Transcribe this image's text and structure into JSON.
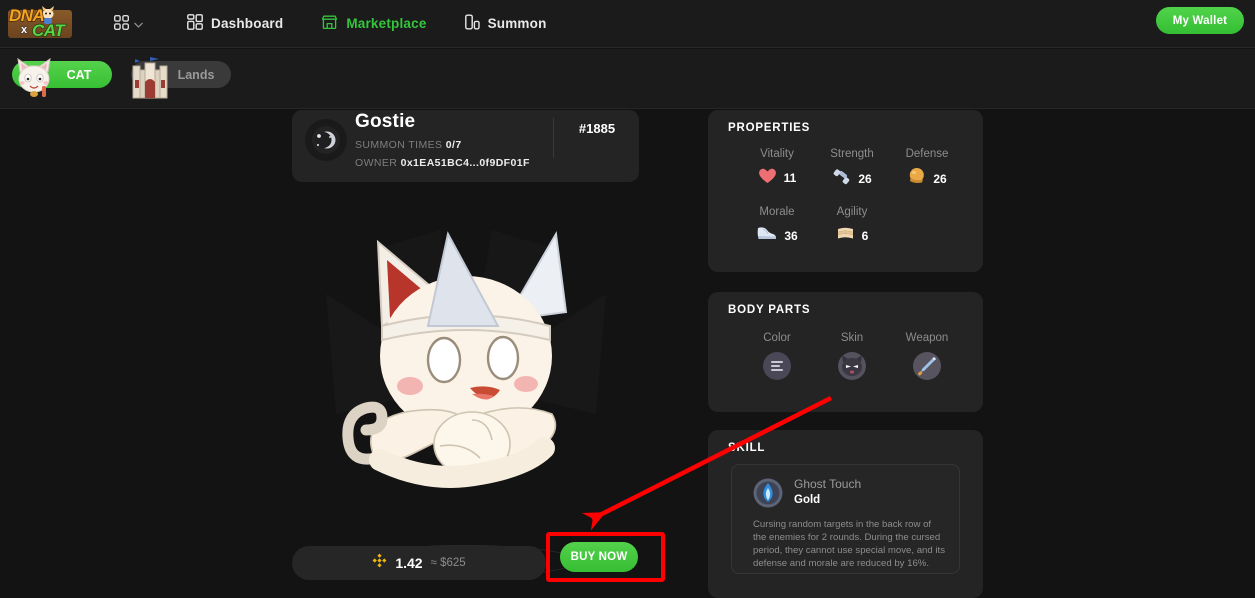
{
  "brand": {
    "logo_primary": "DNA",
    "logo_x": "x",
    "logo_secondary": "CAT"
  },
  "topnav": {
    "grid_icon": "apps-grid-icon",
    "chevron_icon": "chevron-down-icon",
    "items": [
      {
        "label": "Dashboard",
        "icon": "dashboard-icon",
        "active": false
      },
      {
        "label": "Marketplace",
        "icon": "store-icon",
        "active": true
      },
      {
        "label": "Summon",
        "icon": "summon-icon",
        "active": false
      }
    ],
    "wallet_label": "My Wallet"
  },
  "subnav": {
    "tabs": [
      {
        "label": "CAT",
        "icon": "cat-avatar-icon",
        "active": true
      },
      {
        "label": "Lands",
        "icon": "castle-icon",
        "active": false
      }
    ]
  },
  "card": {
    "avatar_icon": "ghost-moon-icon",
    "name": "Gostie",
    "summon_label": "SUMMON TIMES",
    "summon_value": "0/7",
    "owner_label": "OWNER",
    "owner_value": "0x1EA51BC4...0f9DF01F",
    "token_id": "#1885",
    "art_icon": "ghost-cat-art"
  },
  "price": {
    "currency_icon": "bnb-icon",
    "amount": "1.42",
    "approx_symbol": "≈",
    "usd": "$625",
    "buy_label": "BUY NOW"
  },
  "properties": {
    "title": "PROPERTIES",
    "stats": [
      {
        "label": "Vitality",
        "value": "11",
        "icon": "heart-icon"
      },
      {
        "label": "Strength",
        "value": "26",
        "icon": "dumbbell-icon"
      },
      {
        "label": "Defense",
        "value": "26",
        "icon": "shield-ball-icon"
      },
      {
        "label": "Morale",
        "value": "36",
        "icon": "boot-icon"
      },
      {
        "label": "Agility",
        "value": "6",
        "icon": "scroll-icon"
      }
    ]
  },
  "body_parts": {
    "title": "BODY PARTS",
    "parts": [
      {
        "label": "Color",
        "icon": "color-swatch-icon"
      },
      {
        "label": "Skin",
        "icon": "dark-cat-face-icon"
      },
      {
        "label": "Weapon",
        "icon": "sword-icon"
      }
    ]
  },
  "skill": {
    "title": "SKILL",
    "icon": "blue-flame-icon",
    "name": "Ghost Touch",
    "tier": "Gold",
    "description": "Cursing random targets in the back row of the enemies for 2 rounds. During the cursed period, they cannot use special move, and its defense and morale are reduced by 16%."
  },
  "annotation": {
    "arrow_icon": "red-arrow-annotation",
    "highlight_icon": "red-box-highlight",
    "color": "#ff0000"
  },
  "colors": {
    "accent_green": "#34c53c",
    "page_bg": "#131313",
    "panel_bg": "#242424",
    "annotation_red": "#ff0000"
  }
}
